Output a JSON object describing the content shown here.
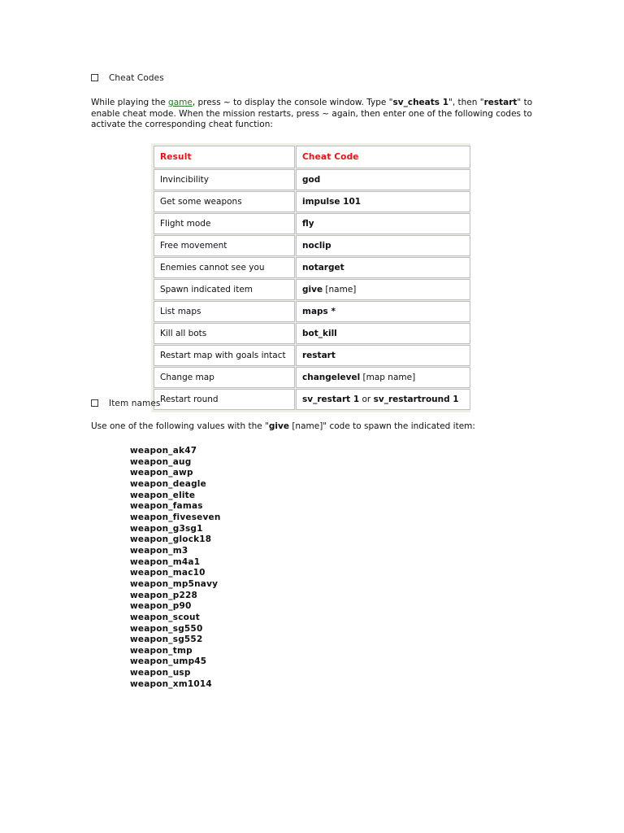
{
  "document": {
    "sections": [
      {
        "id": "cheat-codes",
        "bullet": "hollow-square",
        "title": "Cheat Codes"
      },
      {
        "id": "item-names",
        "bullet": "hollow-square",
        "title": "Item names"
      }
    ],
    "intro_paragraph": {
      "part1": "While playing the ",
      "link_text": "game",
      "part2": ", press ~ to display the console window. Type \"",
      "bold1": "sv_cheats 1",
      "part3": "\", then \"",
      "bold2": "restart",
      "part4": "\" to enable cheat mode. When the mission restarts, press ~ again, then enter one of the following codes to activate the corresponding cheat function:"
    },
    "item_names_paragraph": {
      "part1": "Use one of the following values with the \"",
      "bold1": "give",
      "part2": " [name]\" code to spawn the indicated item:"
    }
  },
  "cheat_table": {
    "headers": [
      "Result",
      "Cheat Code"
    ],
    "header_color": "#ee1111",
    "rows": [
      {
        "result": "Invincibility",
        "code_bold": "god",
        "code_plain": ""
      },
      {
        "result": "Get some weapons",
        "code_bold": "impulse 101",
        "code_plain": ""
      },
      {
        "result": "Flight mode",
        "code_bold": "fly",
        "code_plain": ""
      },
      {
        "result": "Free movement",
        "code_bold": "noclip",
        "code_plain": ""
      },
      {
        "result": "Enemies cannot see you",
        "code_bold": "notarget",
        "code_plain": ""
      },
      {
        "result": "Spawn indicated item",
        "code_bold": "give",
        "code_plain": " [name]"
      },
      {
        "result": "List maps",
        "code_bold": "maps *",
        "code_plain": ""
      },
      {
        "result": "Kill all bots",
        "code_bold": "bot_kill",
        "code_plain": ""
      },
      {
        "result": "Restart map with goals intact",
        "code_bold": "restart",
        "code_plain": ""
      },
      {
        "result": "Change map",
        "code_bold": "changelevel",
        "code_plain": " [map name]"
      },
      {
        "result": "Restart round",
        "code_bold": "sv_restart 1",
        "code_mid": " or ",
        "code_bold2": "sv_restartround 1"
      }
    ]
  },
  "weapon_names": [
    "weapon_ak47",
    "weapon_aug",
    "weapon_awp",
    "weapon_deagle",
    "weapon_elite",
    "weapon_famas",
    "weapon_fiveseven",
    "weapon_g3sg1",
    "weapon_glock18",
    "weapon_m3",
    "weapon_m4a1",
    "weapon_mac10",
    "weapon_mp5navy",
    "weapon_p228",
    "weapon_p90",
    "weapon_scout",
    "weapon_sg550",
    "weapon_sg552",
    "weapon_tmp",
    "weapon_ump45",
    "weapon_usp",
    "weapon_xm1014"
  ]
}
